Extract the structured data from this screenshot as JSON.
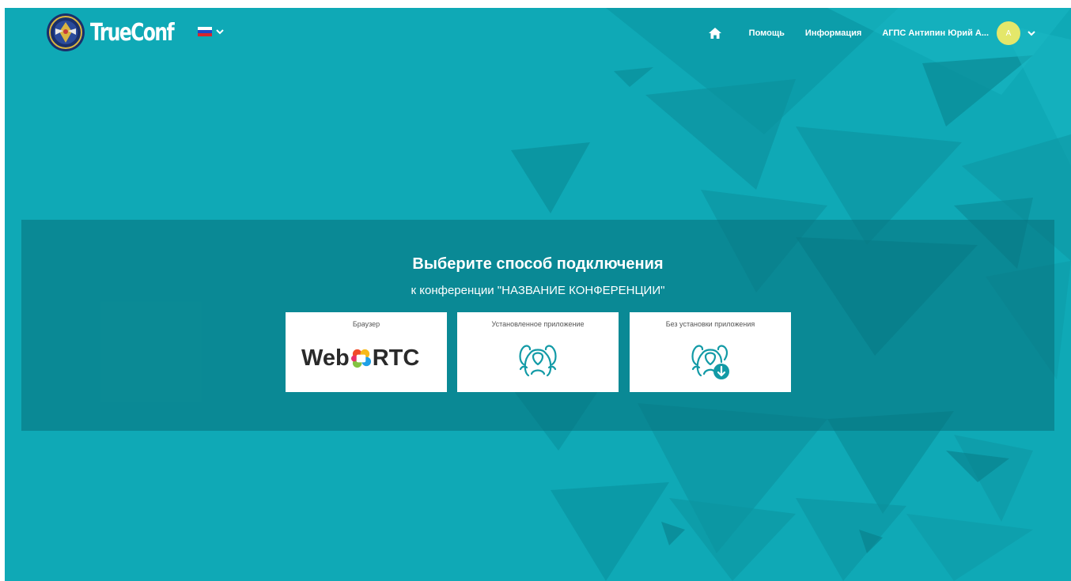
{
  "header": {
    "logo_text": "TrueConf",
    "language": "ru",
    "nav": {
      "help_label": "Помощь",
      "info_label": "Информация",
      "user_name": "АГПС Антипин Юрий А...",
      "avatar_initial": "А"
    }
  },
  "main": {
    "title": "Выберите способ подключения",
    "subtitle": "к конференции \"НАЗВАНИЕ КОНФЕРЕНЦИИ\"",
    "options": [
      {
        "label": "Браузер",
        "logo_text_left": "Web",
        "logo_text_right": "RTC",
        "icon": "webrtc-logo"
      },
      {
        "label": "Установленное приложение",
        "icon": "users-group-icon"
      },
      {
        "label": "Без установки приложения",
        "icon": "users-download-icon"
      }
    ]
  },
  "colors": {
    "background": "#0fa9b6",
    "banner": "#0a7f8a",
    "icon": "#129aa6",
    "avatar": "#e4e76a"
  }
}
